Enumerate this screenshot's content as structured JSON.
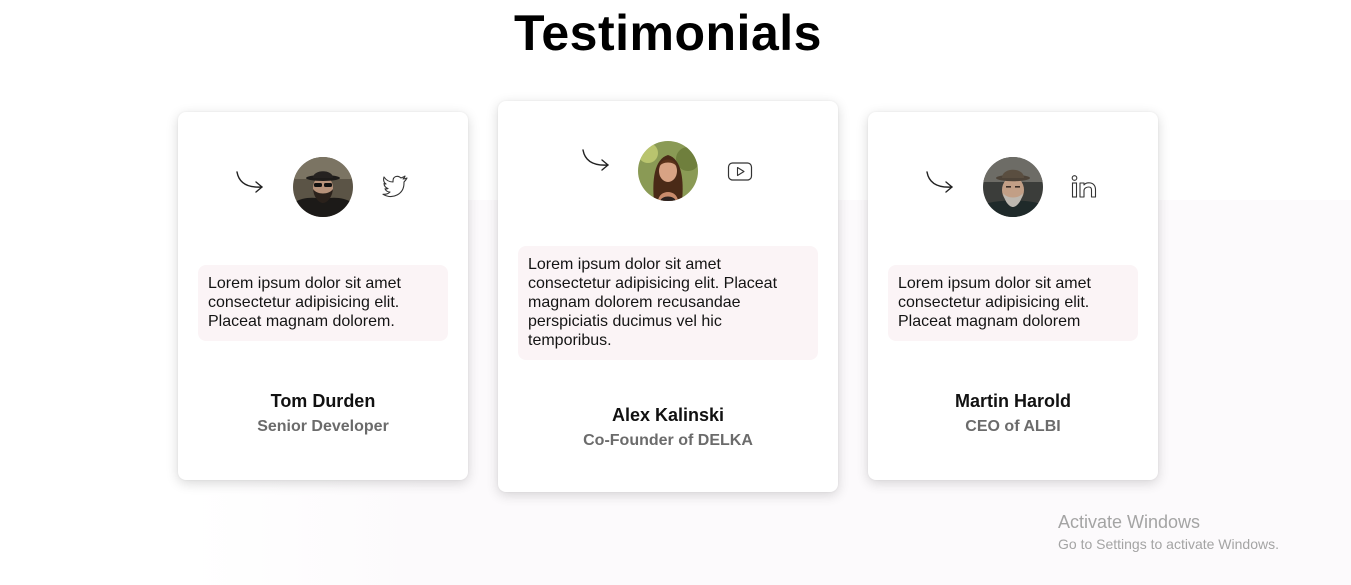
{
  "page": {
    "title": "Testimonials"
  },
  "testimonials": [
    {
      "quote": "Lorem ipsum dolor sit amet consectetur adipisicing elit. Placeat magnam dolorem.",
      "name": "Tom Durden",
      "role": "Senior Developer",
      "social_icon": "twitter-icon",
      "avatar": "avatar-man-with-hat-and-sunglasses"
    },
    {
      "quote": "Lorem ipsum dolor sit amet consectetur adipisicing elit. Placeat magnam dolorem recusandae perspiciatis ducimus vel hic temporibus.",
      "name": "Alex Kalinski",
      "role": "Co-Founder of DELKA",
      "social_icon": "youtube-icon",
      "avatar": "avatar-woman-with-long-hair"
    },
    {
      "quote": "Lorem ipsum dolor sit amet consectetur adipisicing elit. Placeat magnam dolorem",
      "name": "Martin Harold",
      "role": "CEO of ALBI",
      "social_icon": "linkedin-icon",
      "avatar": "avatar-older-man-with-hat"
    }
  ],
  "watermark": {
    "title": "Activate Windows",
    "subtitle": "Go to Settings to activate Windows."
  },
  "colors": {
    "background": "#ffffff",
    "quote_background": "#fbf4f6",
    "role_text": "#6b6b6b",
    "title_text": "#000000"
  }
}
